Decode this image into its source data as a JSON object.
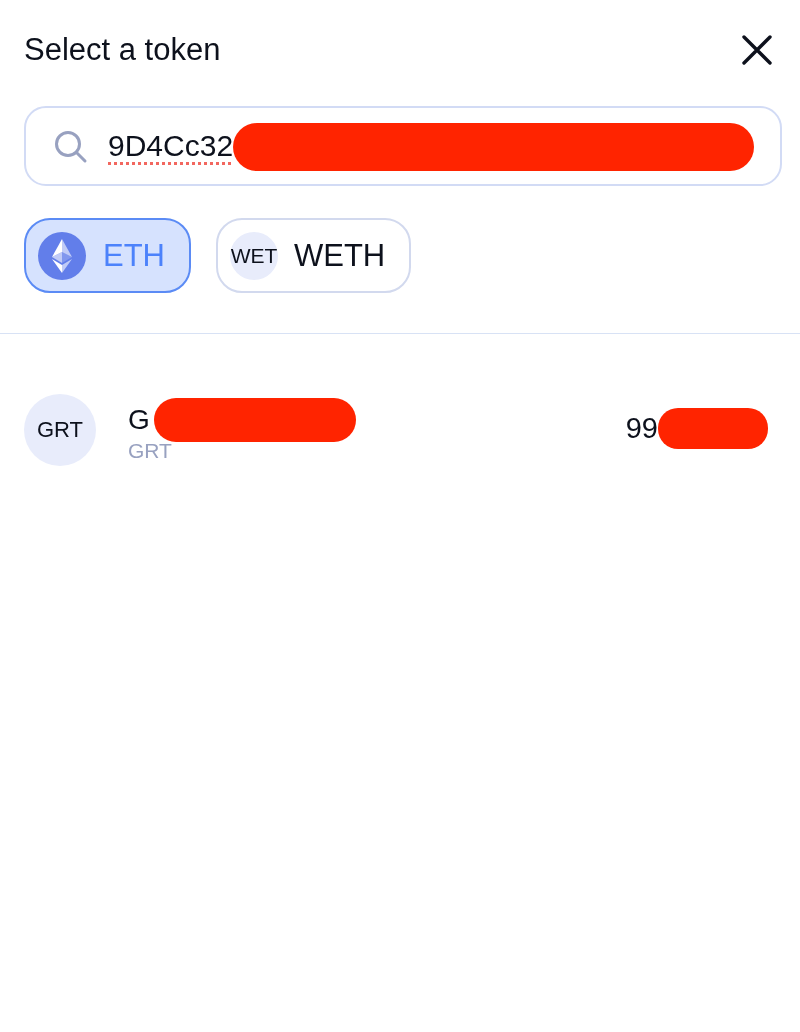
{
  "modal": {
    "title": "Select a token"
  },
  "search": {
    "value": "9D4Cc32",
    "redacted": true
  },
  "common_tokens": [
    {
      "kind": "logo",
      "symbol": "ETH",
      "selected": true
    },
    {
      "kind": "initials",
      "initials": "WET",
      "symbol": "WETH",
      "selected": false
    }
  ],
  "tokens": [
    {
      "initials": "GRT",
      "name": "G",
      "name_redacted": true,
      "symbol": "GRT",
      "balance": "99",
      "balance_redacted": true
    }
  ]
}
